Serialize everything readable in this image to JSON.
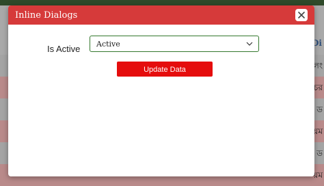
{
  "dialog": {
    "title": "Inline Dialogs",
    "close_icon": "close-icon"
  },
  "form": {
    "is_active_label": "Is Active",
    "is_active_value": "Active",
    "submit_label": "Update Data"
  },
  "background": {
    "header_cell": "Di",
    "row_edge_texts": [
      "লং",
      "চর",
      "ড",
      "য়ম",
      "ড",
      "য়ম",
      "ড"
    ],
    "colors": {
      "topbar": "#2f4a2a",
      "row_pink": "#b98a8a",
      "row_grey": "#a4a4a4"
    }
  },
  "colors": {
    "header": "#d63a3a",
    "button": "#e50d0d",
    "select_border": "#33772c"
  }
}
